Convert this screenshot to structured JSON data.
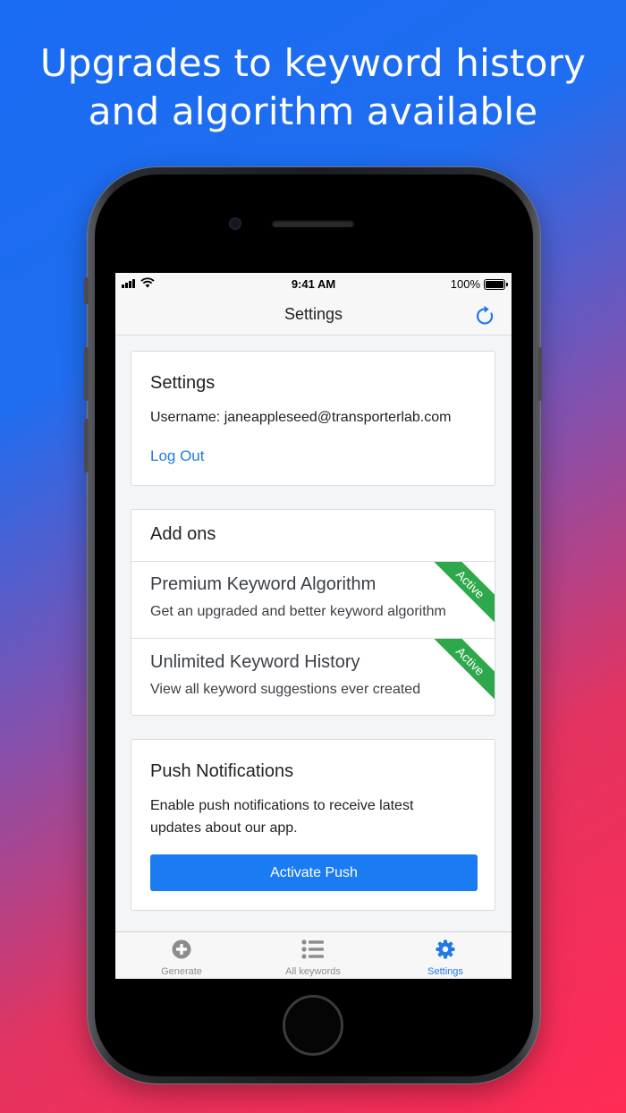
{
  "headline": {
    "line1": "Upgrades to keyword history",
    "line2": "and algorithm available"
  },
  "status_bar": {
    "time": "9:41 AM",
    "battery": "100%"
  },
  "nav": {
    "title": "Settings",
    "refresh_icon": "refresh-icon"
  },
  "settings_card": {
    "title": "Settings",
    "username": "Username: janeappleseed@transporterlab.com",
    "logout": "Log Out"
  },
  "addons_card": {
    "title": "Add ons",
    "items": [
      {
        "name": "Premium Keyword Algorithm",
        "description": "Get an upgraded and better keyword algorithm",
        "badge": "Active"
      },
      {
        "name": "Unlimited Keyword History",
        "description": "View all keyword suggestions ever created",
        "badge": "Active"
      }
    ]
  },
  "push_card": {
    "title": "Push Notifications",
    "description_line1": "Enable push notifications to receive latest",
    "description_line2": "updates about our app.",
    "button": "Activate Push"
  },
  "tabbar": {
    "tabs": [
      {
        "label": "Generate",
        "icon": "plus-circle-icon",
        "active": false
      },
      {
        "label": "All keywords",
        "icon": "list-icon",
        "active": false
      },
      {
        "label": "Settings",
        "icon": "gear-icon",
        "active": true
      }
    ]
  },
  "colors": {
    "accent": "#1f7ae8",
    "badge_green": "#2da84a",
    "button_blue": "#1a7bf2"
  }
}
